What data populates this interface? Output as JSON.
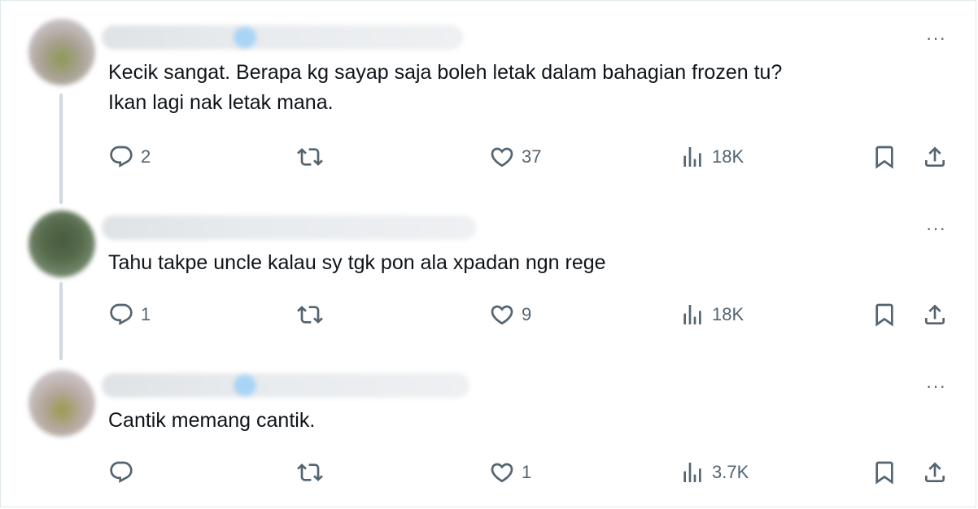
{
  "tweets": [
    {
      "text": "Kecik sangat. Berapa kg sayap saja boleh letak dalam bahagian frozen tu?\nIkan lagi nak letak mana.",
      "replies": "2",
      "retweets": "",
      "likes": "37",
      "views": "18K"
    },
    {
      "text": "Tahu takpe uncle kalau sy tgk pon ala xpadan ngn rege",
      "replies": "1",
      "retweets": "",
      "likes": "9",
      "views": "18K"
    },
    {
      "text": "Cantik memang cantik.",
      "replies": "",
      "retweets": "",
      "likes": "1",
      "views": "3.7K"
    }
  ],
  "more_label": "···",
  "icons": {
    "reply": "reply-icon",
    "retweet": "retweet-icon",
    "like": "heart-icon",
    "views": "views-icon",
    "bookmark": "bookmark-icon",
    "share": "share-icon",
    "more": "more-icon"
  },
  "colors": {
    "icon": "#536471",
    "text": "#0f1419",
    "thread_line": "#cfd9de"
  }
}
